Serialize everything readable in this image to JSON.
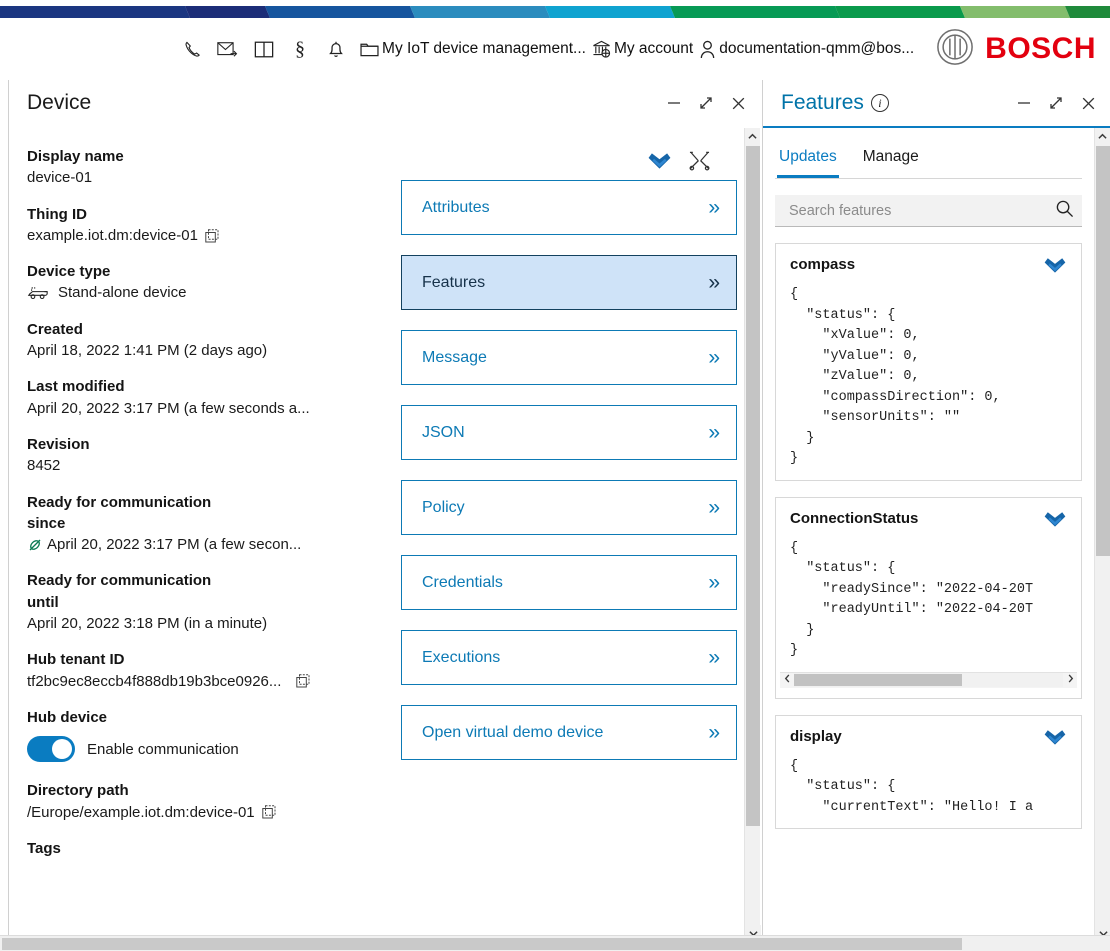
{
  "brand": {
    "name": "BOSCH",
    "logo_icon": "bosch-anchor-icon",
    "accent_red": "#e3000f",
    "accent_blue": "#0a7cc1"
  },
  "ribbon": {
    "colors": [
      "#1b3681",
      "#1c2d78",
      "#16559e",
      "#2b8cbe",
      "#1aa7cf",
      "#0e9e8f",
      "#0c9a4e",
      "#7dba65",
      "#1f8a3b"
    ]
  },
  "header": {
    "icons": [
      {
        "name": "phone-icon",
        "glyph": "✆"
      },
      {
        "name": "mail-icon",
        "glyph": "✉"
      },
      {
        "name": "book-icon",
        "glyph": "◫"
      },
      {
        "name": "section-icon",
        "glyph": "§"
      },
      {
        "name": "bell-icon",
        "glyph": "⭮"
      }
    ],
    "links": [
      {
        "name": "my-iot-device-management",
        "icon": "folder-icon",
        "label": "My IoT device management..."
      },
      {
        "name": "my-account",
        "icon": "bank-icon",
        "label": "My account"
      },
      {
        "name": "user-email",
        "icon": "person-icon",
        "label": "documentation-qmm@bos..."
      }
    ]
  },
  "device_panel": {
    "title": "Device",
    "window_controls": [
      {
        "name": "minimize-button",
        "glyph": "—"
      },
      {
        "name": "expand-button",
        "glyph": "↗"
      },
      {
        "name": "close-button",
        "glyph": "✕"
      }
    ],
    "fields": [
      {
        "label": "Display name",
        "value": "device-01",
        "copy": false,
        "icon": ""
      },
      {
        "label": "Thing ID",
        "value": "example.iot.dm:device-01",
        "copy": true,
        "icon": ""
      },
      {
        "label": "Device type",
        "value": "Stand-alone device",
        "copy": false,
        "icon": "device-icon"
      },
      {
        "label": "Created",
        "value": "April 18, 2022 1:41 PM (2 days ago)",
        "copy": false,
        "icon": ""
      },
      {
        "label": "Last modified",
        "value": "April 20, 2022 3:17 PM (a few seconds a...",
        "copy": false,
        "icon": ""
      },
      {
        "label": "Revision",
        "value": "8452",
        "copy": false,
        "icon": ""
      },
      {
        "label": "Ready for communication since",
        "value": "April 20, 2022 3:17 PM (a few secon...",
        "copy": false,
        "icon": "plug-icon"
      },
      {
        "label": "Ready for communication until",
        "value": "April 20, 2022 3:18 PM (in a minute)",
        "copy": false,
        "icon": ""
      },
      {
        "label": "Hub tenant ID",
        "value": "tf2bc9ec8eccb4f888db19b3bce0926...",
        "copy": true,
        "icon": ""
      }
    ],
    "hub_device": {
      "label": "Hub device",
      "toggle_label": "Enable communication",
      "toggle_on": true
    },
    "directory": {
      "label": "Directory path",
      "value": "/Europe/example.iot.dm:device-01",
      "copy": true
    },
    "tags_label": "Tags",
    "actions": [
      {
        "name": "favorite-icon",
        "title": "Favorite"
      },
      {
        "name": "tools-icon",
        "title": "Tools"
      }
    ],
    "nav_cards": [
      {
        "label": "Attributes",
        "selected": false
      },
      {
        "label": "Features",
        "selected": true
      },
      {
        "label": "Message",
        "selected": false
      },
      {
        "label": "JSON",
        "selected": false
      },
      {
        "label": "Policy",
        "selected": false
      },
      {
        "label": "Credentials",
        "selected": false
      },
      {
        "label": "Executions",
        "selected": false
      },
      {
        "label": "Open virtual demo device",
        "selected": false
      }
    ]
  },
  "features_panel": {
    "title": "Features",
    "info_icon": "info-icon",
    "window_controls": [
      {
        "name": "minimize-button",
        "glyph": "—"
      },
      {
        "name": "expand-button",
        "glyph": "↗"
      },
      {
        "name": "close-button",
        "glyph": "✕"
      }
    ],
    "tabs": [
      {
        "label": "Updates",
        "active": true
      },
      {
        "label": "Manage",
        "active": false
      }
    ],
    "search": {
      "placeholder": "Search features",
      "value": "",
      "icon": "search-icon"
    },
    "cards": [
      {
        "name": "compass",
        "favorite_icon": "favorite-icon",
        "json": "{\n  \"status\": {\n    \"xValue\": 0,\n    \"yValue\": 0,\n    \"zValue\": 0,\n    \"compassDirection\": 0,\n    \"sensorUnits\": \"\"\n  }\n}",
        "hscroll": false
      },
      {
        "name": "ConnectionStatus",
        "favorite_icon": "favorite-icon",
        "json": "{\n  \"status\": {\n    \"readySince\": \"2022-04-20T\n    \"readyUntil\": \"2022-04-20T\n  }\n}",
        "hscroll": true
      },
      {
        "name": "display",
        "favorite_icon": "favorite-icon",
        "json": "{\n  \"status\": {\n    \"currentText\": \"Hello! I a",
        "hscroll": false
      }
    ]
  }
}
